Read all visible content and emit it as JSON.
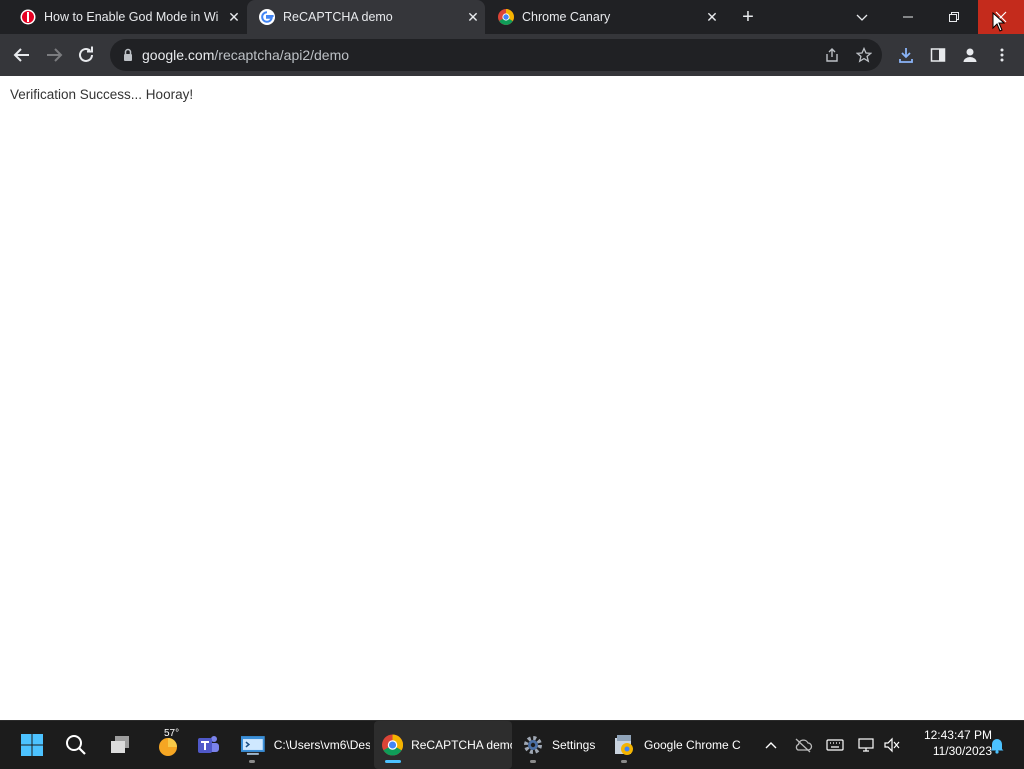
{
  "tabs": [
    {
      "title": "How to Enable God Mode in Wi",
      "favicon": "pinterest-favicon",
      "active": false
    },
    {
      "title": "ReCAPTCHA demo",
      "favicon": "google-favicon",
      "active": true
    },
    {
      "title": "Chrome Canary",
      "favicon": "chrome-favicon",
      "active": false
    }
  ],
  "window_controls": {
    "search_tabs": "chevron-down-icon",
    "minimize": "minimize-icon",
    "restore": "restore-icon",
    "close": "close-icon"
  },
  "toolbar": {
    "url_host": "google.com",
    "url_path": "/recaptcha/api2/demo",
    "icons": [
      "back-arrow-icon",
      "forward-arrow-icon",
      "reload-icon",
      "lock-icon",
      "share-icon",
      "star-icon",
      "download-icon",
      "side-panel-icon",
      "profile-icon",
      "kebab-menu-icon"
    ]
  },
  "page": {
    "message": "Verification Success... Hooray!"
  },
  "taskbar": {
    "weather_temp": "57°",
    "apps": [
      {
        "label": "C:\\Users\\vm6\\Des",
        "icon": "terminal-icon"
      },
      {
        "label": "ReCAPTCHA demo",
        "icon": "chrome-icon"
      },
      {
        "label": "Settings",
        "icon": "settings-gear-icon"
      },
      {
        "label": "Google Chrome C",
        "icon": "installer-icon"
      }
    ],
    "clock_time": "12:43:47 PM",
    "clock_date": "11/30/2023"
  },
  "colors": {
    "accent": "#4cc2ff",
    "close_red": "#c42b1c",
    "tab_active": "#35363a",
    "chrome_bg": "#202124"
  }
}
